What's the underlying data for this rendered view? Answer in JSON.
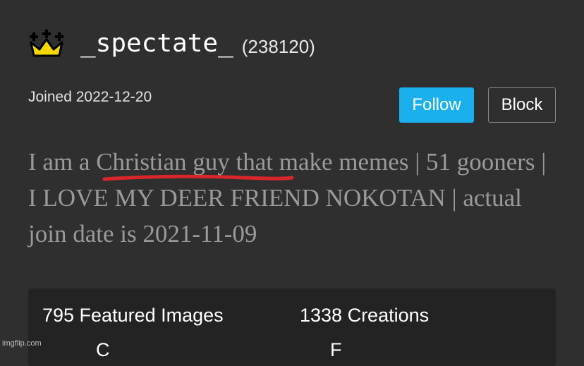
{
  "profile": {
    "username": "_spectate_",
    "points": "(238120)",
    "joined": "Joined 2022-12-20",
    "bio": "I am a Christian guy that make memes | 51 gooners | I LOVE MY DEER FRIEND NOKOTAN | actual join date is 2021-11-09"
  },
  "actions": {
    "follow_label": "Follow",
    "block_label": "Block"
  },
  "stats": {
    "featured_images": "795 Featured Images",
    "creations": "1338 Creations",
    "row2_left": "C",
    "row2_right": "F"
  },
  "watermark": "imgflip.com",
  "icons": {
    "crown": "crown-icon",
    "underline": "red-underline-annotation"
  },
  "colors": {
    "background": "#2f2f2f",
    "follow_button": "#1ab0ee",
    "stats_panel": "#232323",
    "bio_text": "#9a9a9a",
    "crown_gold": "#f5d800",
    "underline_red": "#d8262b"
  }
}
